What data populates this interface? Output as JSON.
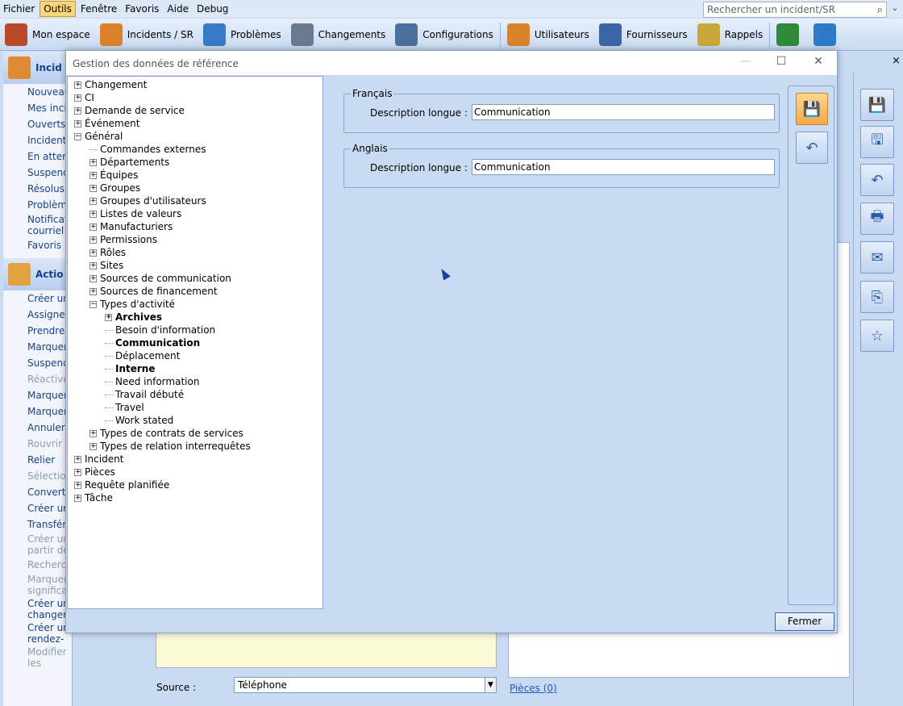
{
  "menubar": {
    "items": [
      {
        "label": "Fichier",
        "active": false
      },
      {
        "label": "Outils",
        "active": true
      },
      {
        "label": "Fenêtre",
        "active": false
      },
      {
        "label": "Favoris",
        "active": false
      },
      {
        "label": "Aide",
        "active": false
      },
      {
        "label": "Debug",
        "active": false
      }
    ],
    "search_placeholder": "Rechercher un incident/SR"
  },
  "toolbar": [
    {
      "label": "Mon espace",
      "icon": "house-icon",
      "color": "#b84a2a"
    },
    {
      "label": "Incidents / SR",
      "icon": "user-computer-icon",
      "color": "#d9822b"
    },
    {
      "label": "Problèmes",
      "icon": "cloud-icon",
      "color": "#3a79c8"
    },
    {
      "label": "Changements",
      "icon": "document-icon",
      "color": "#6b7a90"
    },
    {
      "label": "Configurations",
      "icon": "computer-network-icon",
      "color": "#4d6f9e"
    },
    {
      "label": "Utilisateurs",
      "icon": "users-icon",
      "color": "#d9822b"
    },
    {
      "label": "Fournisseurs",
      "icon": "building-icon",
      "color": "#3d66a8"
    },
    {
      "label": "Rappels",
      "icon": "clock-icon",
      "color": "#c8a83a"
    },
    {
      "label": "",
      "icon": "line-chart-icon",
      "color": "#2f8a3a"
    },
    {
      "label": "",
      "icon": "bar-chart-icon",
      "color": "#2f7ac8"
    }
  ],
  "left_panel": {
    "section1_title": "Incid",
    "section1_items": [
      {
        "label": "Nouveau",
        "disabled": false
      },
      {
        "label": "Mes incid",
        "disabled": false
      },
      {
        "label": "Ouverts",
        "disabled": false
      },
      {
        "label": "Incidents",
        "disabled": false
      },
      {
        "label": "En attent",
        "disabled": false
      },
      {
        "label": "Suspendu",
        "disabled": false
      },
      {
        "label": "Résolus",
        "disabled": false
      },
      {
        "label": "Problème",
        "disabled": false
      },
      {
        "label": "Notificati courriel a",
        "disabled": false
      },
      {
        "label": "Favoris",
        "disabled": false
      }
    ],
    "section2_title": "Actio",
    "section2_items": [
      {
        "label": "Créer un",
        "disabled": false
      },
      {
        "label": "Assigner",
        "disabled": false
      },
      {
        "label": "Prendre e",
        "disabled": false
      },
      {
        "label": "Marquer",
        "disabled": false
      },
      {
        "label": "Suspendr",
        "disabled": false
      },
      {
        "label": "Réactiver",
        "disabled": true
      },
      {
        "label": "Marquer",
        "disabled": false
      },
      {
        "label": "Marquer",
        "disabled": false
      },
      {
        "label": "Annuler",
        "disabled": false
      },
      {
        "label": "Rouvrir",
        "disabled": true
      },
      {
        "label": "Relier",
        "disabled": false
      },
      {
        "label": "Sélection",
        "disabled": true
      },
      {
        "label": "Convertir",
        "disabled": false
      },
      {
        "label": "Créer un",
        "disabled": false
      },
      {
        "label": "Transfére",
        "disabled": false
      },
      {
        "label": "Créer un partir de",
        "disabled": true
      },
      {
        "label": "Recherch",
        "disabled": true
      },
      {
        "label": "Marquer significat",
        "disabled": true
      },
      {
        "label": "Créer un changement à partir de cet incident",
        "disabled": false
      },
      {
        "label": "Créer un rendez-vous",
        "disabled": false
      },
      {
        "label": "Modifier les données",
        "disabled": true
      }
    ]
  },
  "background": {
    "source_label": "Source :",
    "source_value": "Téléphone",
    "pieces_link": "Pièces (0)",
    "close_x": "×"
  },
  "dialog": {
    "title": "Gestion des données de référence",
    "tree": [
      {
        "label": "Changement",
        "level": 0,
        "expander": "+",
        "bold": false
      },
      {
        "label": "CI",
        "level": 0,
        "expander": "+",
        "bold": false
      },
      {
        "label": "Demande de service",
        "level": 0,
        "expander": "+",
        "bold": false
      },
      {
        "label": "Événement",
        "level": 0,
        "expander": "+",
        "bold": false
      },
      {
        "label": "Général",
        "level": 0,
        "expander": "-",
        "bold": false
      },
      {
        "label": "Commandes externes",
        "level": 1,
        "expander": "",
        "bold": false
      },
      {
        "label": "Départements",
        "level": 1,
        "expander": "+",
        "bold": false
      },
      {
        "label": "Équipes",
        "level": 1,
        "expander": "+",
        "bold": false
      },
      {
        "label": "Groupes",
        "level": 1,
        "expander": "+",
        "bold": false
      },
      {
        "label": "Groupes d'utilisateurs",
        "level": 1,
        "expander": "+",
        "bold": false
      },
      {
        "label": "Listes de valeurs",
        "level": 1,
        "expander": "+",
        "bold": false
      },
      {
        "label": "Manufacturiers",
        "level": 1,
        "expander": "+",
        "bold": false
      },
      {
        "label": "Permissions",
        "level": 1,
        "expander": "+",
        "bold": false
      },
      {
        "label": "Rôles",
        "level": 1,
        "expander": "+",
        "bold": false
      },
      {
        "label": "Sites",
        "level": 1,
        "expander": "+",
        "bold": false
      },
      {
        "label": "Sources de communication",
        "level": 1,
        "expander": "+",
        "bold": false
      },
      {
        "label": "Sources de financement",
        "level": 1,
        "expander": "+",
        "bold": false
      },
      {
        "label": "Types d'activité",
        "level": 1,
        "expander": "-",
        "bold": false
      },
      {
        "label": "Archives",
        "level": 2,
        "expander": "+",
        "bold": true
      },
      {
        "label": "Besoin d'information",
        "level": 2,
        "expander": "",
        "bold": false
      },
      {
        "label": "Communication",
        "level": 2,
        "expander": "",
        "bold": true
      },
      {
        "label": "Déplacement",
        "level": 2,
        "expander": "",
        "bold": false
      },
      {
        "label": "Interne",
        "level": 2,
        "expander": "",
        "bold": true
      },
      {
        "label": "Need information",
        "level": 2,
        "expander": "",
        "bold": false
      },
      {
        "label": "Travail débuté",
        "level": 2,
        "expander": "",
        "bold": false
      },
      {
        "label": "Travel",
        "level": 2,
        "expander": "",
        "bold": false
      },
      {
        "label": "Work stated",
        "level": 2,
        "expander": "",
        "bold": false
      },
      {
        "label": "Types de contrats de services",
        "level": 1,
        "expander": "+",
        "bold": false
      },
      {
        "label": "Types de relation interrequêtes",
        "level": 1,
        "expander": "+",
        "bold": false
      },
      {
        "label": "Incident",
        "level": 0,
        "expander": "+",
        "bold": false
      },
      {
        "label": "Pièces",
        "level": 0,
        "expander": "+",
        "bold": false
      },
      {
        "label": "Requête planifiée",
        "level": 0,
        "expander": "+",
        "bold": false
      },
      {
        "label": "Tâche",
        "level": 0,
        "expander": "+",
        "bold": false
      }
    ],
    "francais": {
      "group_title": "Français",
      "field_label": "Description longue :",
      "field_value": "Communication"
    },
    "anglais": {
      "group_title": "Anglais",
      "field_label": "Description longue :",
      "field_value": "Communication"
    },
    "close_button": "Fermer"
  }
}
